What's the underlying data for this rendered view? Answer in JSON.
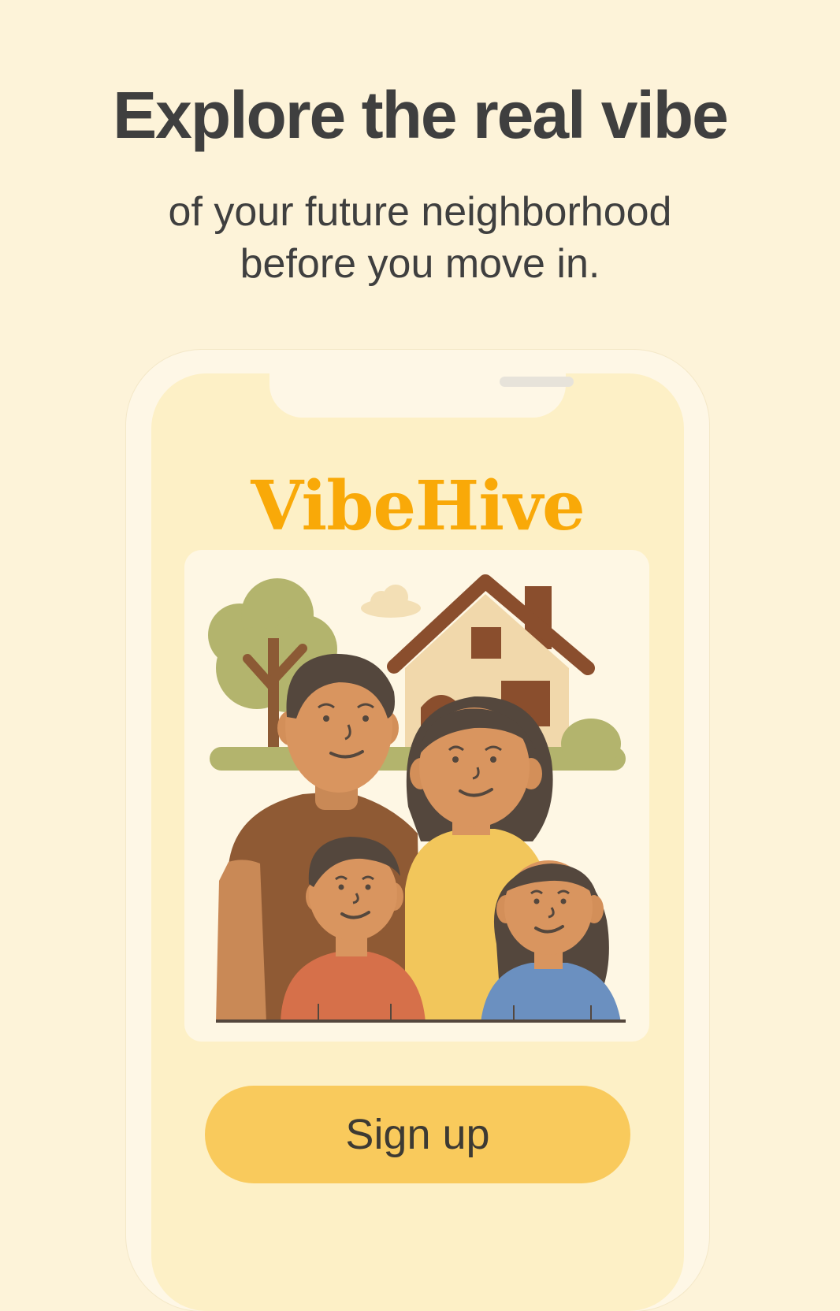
{
  "hero": {
    "headline": "Explore the real vibe",
    "subline_1": "of your future neighborhood",
    "subline_2": "before you move in."
  },
  "app": {
    "brand_name": "VibeHive",
    "signup_label": "Sign up",
    "accent_color": "#f9a908",
    "button_color": "#f9ca5c"
  }
}
